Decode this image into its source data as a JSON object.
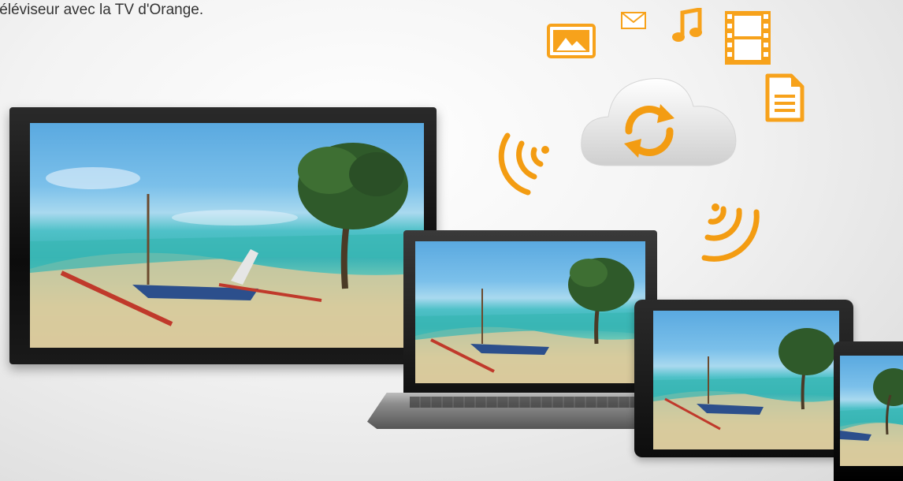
{
  "caption": "téléviseur avec la TV d'Orange.",
  "colors": {
    "accent": "#f39c12",
    "accent_light": "#f7b733",
    "cloud": "#e6e6e6",
    "device_frame": "#111111"
  },
  "icons": {
    "photo": "photo-icon",
    "mail": "mail-icon",
    "music": "music-note-icon",
    "film": "film-icon",
    "document": "document-icon",
    "sync": "sync-icon",
    "wifi_left": "wifi-signal-icon",
    "wifi_right": "wifi-signal-icon"
  },
  "devices": [
    "tv",
    "laptop",
    "tablet",
    "smartphone"
  ]
}
